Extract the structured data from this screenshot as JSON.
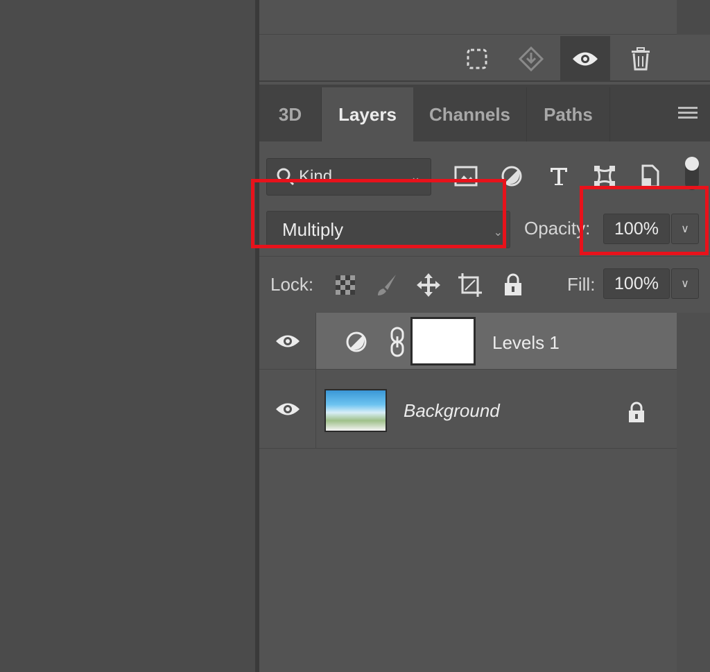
{
  "properties_footer": {
    "icons": [
      "selection-mask-icon",
      "load-selection-icon",
      "visibility-eye-icon",
      "trash-icon"
    ]
  },
  "tabs": [
    {
      "label": "3D",
      "active": false
    },
    {
      "label": "Layers",
      "active": true
    },
    {
      "label": "Channels",
      "active": false
    },
    {
      "label": "Paths",
      "active": false
    }
  ],
  "filter": {
    "kind_label": "Kind",
    "filter_icons": [
      "pixel-layer-filter-icon",
      "adjustment-filter-icon",
      "type-filter-icon",
      "shape-filter-icon",
      "smart-object-filter-icon",
      "filter-toggle-icon"
    ]
  },
  "blend": {
    "mode": "Multiply",
    "opacity_label": "Opacity:",
    "opacity_value": "100%"
  },
  "lock": {
    "label": "Lock:",
    "fill_label": "Fill:",
    "fill_value": "100%"
  },
  "layers": [
    {
      "name": "Levels 1",
      "type": "adjustment",
      "visible": true,
      "selected": true
    },
    {
      "name": "Background",
      "type": "image",
      "visible": true,
      "locked": true,
      "selected": false
    }
  ],
  "colors": {
    "highlight": "#e8121b",
    "panel": "#535353",
    "tab_bar": "#424242",
    "selected_layer": "#696969"
  }
}
